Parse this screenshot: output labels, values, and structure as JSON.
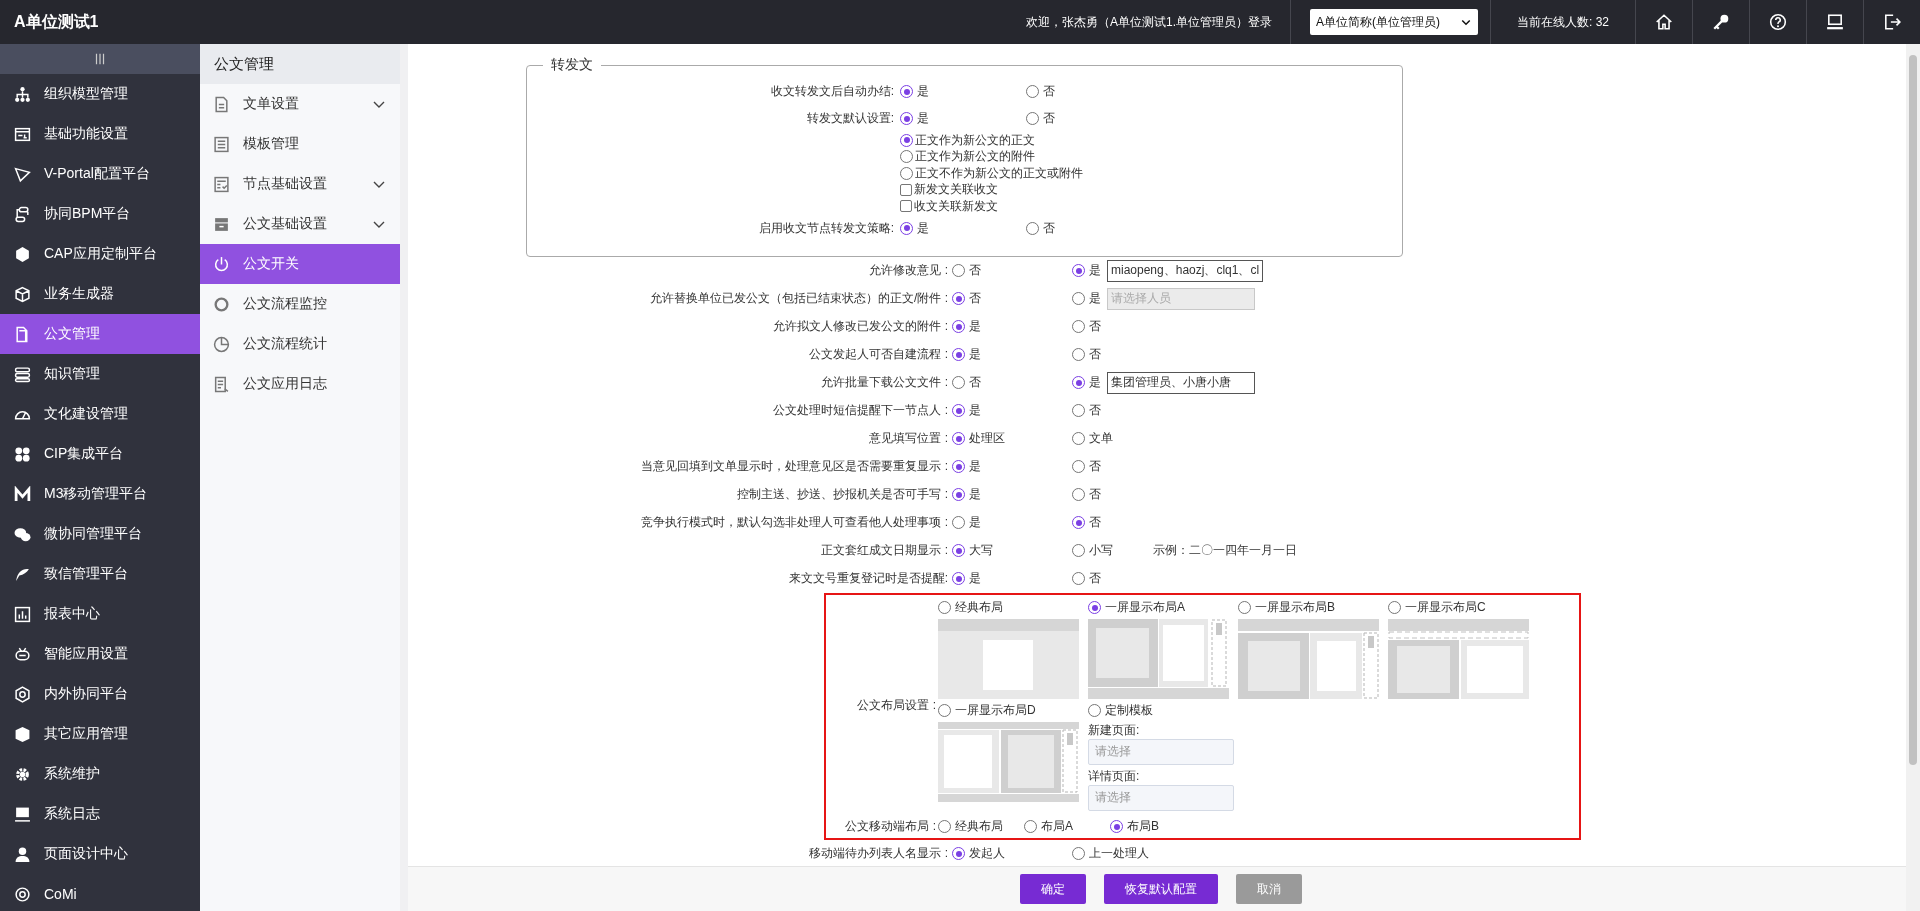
{
  "app": {
    "title": "A单位测试1"
  },
  "header": {
    "welcome": "欢迎，张杰勇（A单位测试1.单位管理员）登录",
    "unit_select": {
      "value": "A单位简称(单位管理员)"
    },
    "online": "当前在线人数: 32"
  },
  "sidebar": {
    "items": [
      {
        "label": "组织模型管理",
        "selected": false
      },
      {
        "label": "基础功能设置",
        "selected": false
      },
      {
        "label": "V-Portal配置平台",
        "selected": false
      },
      {
        "label": "协同BPM平台",
        "selected": false
      },
      {
        "label": "CAP应用定制平台",
        "selected": false
      },
      {
        "label": "业务生成器",
        "selected": false
      },
      {
        "label": "公文管理",
        "selected": true
      },
      {
        "label": "知识管理",
        "selected": false
      },
      {
        "label": "文化建设管理",
        "selected": false
      },
      {
        "label": "CIP集成平台",
        "selected": false
      },
      {
        "label": "M3移动管理平台",
        "selected": false
      },
      {
        "label": "微协同管理平台",
        "selected": false
      },
      {
        "label": "致信管理平台",
        "selected": false
      },
      {
        "label": "报表中心",
        "selected": false
      },
      {
        "label": "智能应用设置",
        "selected": false
      },
      {
        "label": "内外协同平台",
        "selected": false
      },
      {
        "label": "其它应用管理",
        "selected": false
      },
      {
        "label": "系统维护",
        "selected": false
      },
      {
        "label": "系统日志",
        "selected": false
      },
      {
        "label": "页面设计中心",
        "selected": false
      },
      {
        "label": "CoMi",
        "selected": false
      }
    ]
  },
  "submenu": {
    "title": "公文管理",
    "items": [
      {
        "label": "文单设置",
        "expandable": true,
        "selected": false
      },
      {
        "label": "模板管理",
        "expandable": false,
        "selected": false
      },
      {
        "label": "节点基础设置",
        "expandable": true,
        "selected": false
      },
      {
        "label": "公文基础设置",
        "expandable": true,
        "selected": false
      },
      {
        "label": "公文开关",
        "expandable": false,
        "selected": true
      },
      {
        "label": "公文流程监控",
        "expandable": false,
        "selected": false
      },
      {
        "label": "公文流程统计",
        "expandable": false,
        "selected": false
      },
      {
        "label": "公文应用日志",
        "expandable": false,
        "selected": false
      }
    ]
  },
  "forward_section": {
    "legend": "转发文",
    "rows": [
      {
        "label": "收文转发文后自动办结:",
        "options": [
          {
            "label": "是",
            "selected": true
          },
          {
            "label": "否",
            "selected": false
          }
        ]
      },
      {
        "label": "转发文默认设置:",
        "options": [
          {
            "label": "是",
            "selected": true
          },
          {
            "label": "否",
            "selected": false
          }
        ],
        "sub_options": [
          {
            "kind": "radio",
            "label": "正文作为新公文的正文",
            "checked": true
          },
          {
            "kind": "radio",
            "label": "正文作为新公文的附件",
            "checked": false
          },
          {
            "kind": "radio",
            "label": "正文不作为新公文的正文或附件",
            "checked": false
          },
          {
            "kind": "checkbox",
            "label": "新发文关联收文",
            "checked": false
          },
          {
            "kind": "checkbox",
            "label": "收文关联新发文",
            "checked": false
          }
        ]
      },
      {
        "label": "启用收文节点转发文策略:",
        "options": [
          {
            "label": "是",
            "selected": true
          },
          {
            "label": "否",
            "selected": false
          }
        ]
      }
    ]
  },
  "settings": [
    {
      "label": "允许修改意见 :",
      "options": [
        {
          "label": "否",
          "selected": false
        },
        {
          "label": "是",
          "selected": true
        }
      ],
      "field": {
        "value": "miaopeng、haozj、clq1、cl",
        "disabled": false
      }
    },
    {
      "label": "允许替换单位已发公文（包括已结束状态）的正文/附件 :",
      "options": [
        {
          "label": "否",
          "selected": true
        },
        {
          "label": "是",
          "selected": false
        }
      ],
      "field": {
        "placeholder": "请选择人员",
        "disabled": true
      }
    },
    {
      "label": "允许拟文人修改已发公文的附件 :",
      "options": [
        {
          "label": "是",
          "selected": true
        },
        {
          "label": "否",
          "selected": false
        }
      ]
    },
    {
      "label": "公文发起人可否自建流程 :",
      "options": [
        {
          "label": "是",
          "selected": true
        },
        {
          "label": "否",
          "selected": false
        }
      ]
    },
    {
      "label": "允许批量下载公文文件 :",
      "options": [
        {
          "label": "否",
          "selected": false
        },
        {
          "label": "是",
          "selected": true
        }
      ],
      "field": {
        "value": "集团管理员、小唐小唐",
        "disabled": false
      }
    },
    {
      "label": "公文处理时短信提醒下一节点人 :",
      "options": [
        {
          "label": "是",
          "selected": true
        },
        {
          "label": "否",
          "selected": false
        }
      ]
    },
    {
      "label": "意见填写位置 :",
      "options": [
        {
          "label": "处理区",
          "selected": true
        },
        {
          "label": "文单",
          "selected": false
        }
      ]
    },
    {
      "label": "当意见回填到文单显示时，处理意见区是否需要重复显示 :",
      "options": [
        {
          "label": "是",
          "selected": true
        },
        {
          "label": "否",
          "selected": false
        }
      ]
    },
    {
      "label": "控制主送、抄送、抄报机关是否可手写 :",
      "options": [
        {
          "label": "是",
          "selected": true
        },
        {
          "label": "否",
          "selected": false
        }
      ]
    },
    {
      "label": "竞争执行模式时，默认勾选非处理人可查看他人处理事项 :",
      "options": [
        {
          "label": "是",
          "selected": false
        },
        {
          "label": "否",
          "selected": true
        }
      ]
    },
    {
      "label": "正文套红成文日期显示 :",
      "options": [
        {
          "label": "大写",
          "selected": true
        },
        {
          "label": "小写",
          "selected": false
        }
      ],
      "note": "示例：二〇一四年一月一日"
    },
    {
      "label": "来文文号重复登记时是否提醒:",
      "options": [
        {
          "label": "是",
          "selected": true
        },
        {
          "label": "否",
          "selected": false
        }
      ]
    }
  ],
  "layout_settings": {
    "label": "公文布局设置 :",
    "options": [
      {
        "label": "经典布局",
        "selected": false
      },
      {
        "label": "一屏显示布局A",
        "selected": true
      },
      {
        "label": "一屏显示布局B",
        "selected": false
      },
      {
        "label": "一屏显示布局C",
        "selected": false
      },
      {
        "label": "一屏显示布局D",
        "selected": false
      }
    ],
    "custom": {
      "label": "定制模板",
      "selected": false,
      "fields": [
        {
          "label": "新建页面:",
          "placeholder": "请选择"
        },
        {
          "label": "详情页面:",
          "placeholder": "请选择"
        }
      ]
    },
    "mobile": {
      "label": "公文移动端布局 :",
      "options": [
        {
          "label": "经典布局",
          "selected": false
        },
        {
          "label": "布局A",
          "selected": false
        },
        {
          "label": "布局B",
          "selected": true
        }
      ]
    }
  },
  "mobile_todo": {
    "label": "移动端待办列表人名显示 :",
    "options": [
      {
        "label": "发起人",
        "selected": true
      },
      {
        "label": "上一处理人",
        "selected": false
      }
    ]
  },
  "buttons": [
    {
      "label": "确定",
      "kind": "primary"
    },
    {
      "label": "恢复默认配置",
      "kind": "primary"
    },
    {
      "label": "取消",
      "kind": "muted"
    }
  ]
}
